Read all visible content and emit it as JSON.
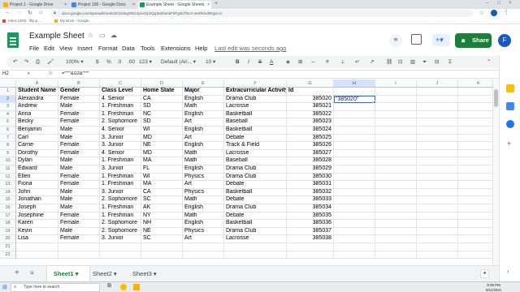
{
  "browser": {
    "tabs": [
      {
        "label": "Project 1 - Google Drive",
        "color": "#f4b400"
      },
      {
        "label": "Project 100 - Google Docs",
        "color": "#4285f4"
      },
      {
        "label": "Example Sheet - Google Sheets",
        "color": "#0f9d58"
      }
    ],
    "url": "docs.google.com/spreadsheets/d/1Sdeg20k14jmxOp2Qq3u5heekF5Fgsb7f5uY-4wRk/edit#gid=0",
    "bookmarks": [
      "Inbox (203) - filip.p...",
      "My Drive - Google..."
    ]
  },
  "app": {
    "title": "Example Sheet",
    "menus": [
      "File",
      "Edit",
      "View",
      "Insert",
      "Format",
      "Data",
      "Tools",
      "Extensions",
      "Help"
    ],
    "last_edit": "Last edit was seconds ago",
    "share_label": "Share",
    "avatar_initial": "F"
  },
  "toolbar": {
    "zoom": "100%",
    "currency": "$",
    "percent": "%",
    "dec_decrease": ".0",
    "dec_increase": ".00",
    "format_more": "123",
    "font": "Default (Ari...",
    "font_size": "10"
  },
  "formula_bar": {
    "name_box": "H2",
    "fx": "fx",
    "formula": "=\"\"\"\"&G2&\"\"\"\""
  },
  "grid": {
    "columns": [
      "A",
      "B",
      "C",
      "D",
      "E",
      "F",
      "G",
      "H",
      "I",
      "J",
      "K"
    ],
    "rows": [
      "1",
      "2",
      "3",
      "4",
      "5",
      "6",
      "7",
      "8",
      "9",
      "10",
      "11",
      "12",
      "13",
      "14",
      "15",
      "16",
      "17",
      "18",
      "19",
      "20",
      "21",
      "22"
    ],
    "data": [
      [
        "Student Name",
        "Gender",
        "Class Level",
        "Home State",
        "Major",
        "Extracurricular Activity",
        "Id",
        "",
        "",
        "",
        ""
      ],
      [
        "Alexandra",
        "Female",
        "4. Senior",
        "CA",
        "English",
        "Drama Club",
        "385020",
        "\"385020\"",
        "",
        "",
        ""
      ],
      [
        "Andrew",
        "Male",
        "1. Freshman",
        "SD",
        "Math",
        "Lacrosse",
        "385021",
        "",
        "",
        "",
        ""
      ],
      [
        "Anna",
        "Female",
        "1. Freshman",
        "NC",
        "English",
        "Basketball",
        "385022",
        "",
        "",
        "",
        ""
      ],
      [
        "Becky",
        "Female",
        "2. Sophomore",
        "SD",
        "Art",
        "Baseball",
        "385023",
        "",
        "",
        "",
        ""
      ],
      [
        "Benjamin",
        "Male",
        "4. Senior",
        "WI",
        "English",
        "Basketball",
        "385024",
        "",
        "",
        "",
        ""
      ],
      [
        "Carl",
        "Male",
        "3. Junior",
        "MD",
        "Art",
        "Debate",
        "385025",
        "",
        "",
        "",
        ""
      ],
      [
        "Carrie",
        "Female",
        "3. Junior",
        "NE",
        "English",
        "Track & Field",
        "385026",
        "",
        "",
        "",
        ""
      ],
      [
        "Dorothy",
        "Female",
        "4. Senior",
        "MD",
        "Math",
        "Lacrosse",
        "385027",
        "",
        "",
        "",
        ""
      ],
      [
        "Dylan",
        "Male",
        "1. Freshman",
        "MA",
        "Math",
        "Baseball",
        "385028",
        "",
        "",
        "",
        ""
      ],
      [
        "Edward",
        "Male",
        "3. Junior",
        "FL",
        "English",
        "Drama Club",
        "385029",
        "",
        "",
        "",
        ""
      ],
      [
        "Ellen",
        "Female",
        "1. Freshman",
        "WI",
        "Physics",
        "Drama Club",
        "385030",
        "",
        "",
        "",
        ""
      ],
      [
        "Fiona",
        "Female",
        "1. Freshman",
        "MA",
        "Art",
        "Debate",
        "385031",
        "",
        "",
        "",
        ""
      ],
      [
        "John",
        "Male",
        "3. Junior",
        "CA",
        "Physics",
        "Basketball",
        "385032",
        "",
        "",
        "",
        ""
      ],
      [
        "Jonathan",
        "Male",
        "2. Sophomore",
        "SC",
        "Math",
        "Debate",
        "385033",
        "",
        "",
        "",
        ""
      ],
      [
        "Joseph",
        "Male",
        "1. Freshman",
        "AK",
        "English",
        "Drama Club",
        "385034",
        "",
        "",
        "",
        ""
      ],
      [
        "Josephine",
        "Female",
        "1. Freshman",
        "NY",
        "Math",
        "Debate",
        "385035",
        "",
        "",
        "",
        ""
      ],
      [
        "Karen",
        "Female",
        "2. Sophomore",
        "NH",
        "English",
        "Basketball",
        "385036",
        "",
        "",
        "",
        ""
      ],
      [
        "Kevin",
        "Male",
        "2. Sophomore",
        "NE",
        "Physics",
        "Drama Club",
        "385037",
        "",
        "",
        "",
        ""
      ],
      [
        "Lisa",
        "Female",
        "3. Junior",
        "SC",
        "Art",
        "Lacrosse",
        "385038",
        "",
        "",
        "",
        ""
      ],
      [
        "",
        "",
        "",
        "",
        "",
        "",
        "",
        "",
        "",
        "",
        ""
      ]
    ]
  },
  "sheets": {
    "tabs": [
      "Sheet1",
      "Sheet2",
      "Sheet3"
    ],
    "active": "Sheet1",
    "add_label": "+"
  },
  "taskbar": {
    "search_placeholder": "Type here to search",
    "time": "9:06 PM",
    "date": "8/11/2021"
  },
  "colors": {
    "sheets_green": "#0f9d58",
    "share_green": "#188038",
    "selection_blue": "#1a73e8",
    "avatar_blue": "#1a56c6"
  }
}
